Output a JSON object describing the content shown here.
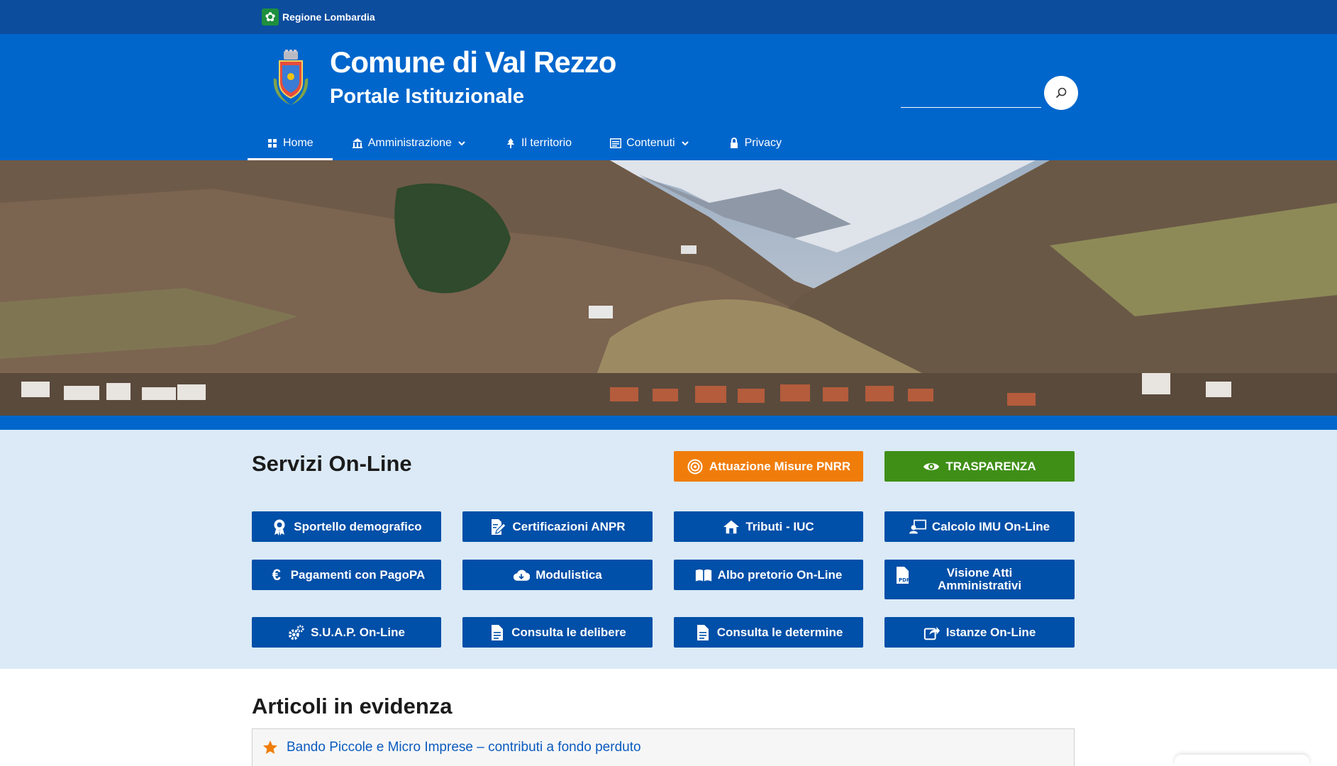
{
  "region": {
    "label": "Regione Lombardia"
  },
  "header": {
    "title": "Comune di Val Rezzo",
    "subtitle": "Portale Istituzionale",
    "search": {
      "value": "",
      "placeholder": ""
    }
  },
  "nav": [
    {
      "label": "Home",
      "icon": "grid-icon",
      "active": true
    },
    {
      "label": "Amministrazione",
      "icon": "building-icon",
      "dropdown": true
    },
    {
      "label": "Il territorio",
      "icon": "tree-icon"
    },
    {
      "label": "Contenuti",
      "icon": "list-icon",
      "dropdown": true
    },
    {
      "label": "Privacy",
      "icon": "lock-icon"
    }
  ],
  "services": {
    "title": "Servizi On-Line",
    "highlight": [
      {
        "label": "Attuazione Misure PNRR",
        "icon": "target-icon",
        "color": "#f07d0a"
      },
      {
        "label": "TRASPARENZA",
        "icon": "eye-icon",
        "color": "#3f8f17"
      }
    ],
    "buttons": [
      {
        "label": "Sportello demografico",
        "icon": "badge-icon"
      },
      {
        "label": "Certificazioni ANPR",
        "icon": "document-edit-icon"
      },
      {
        "label": "Tributi - IUC",
        "icon": "house-icon"
      },
      {
        "label": "Calcolo IMU On-Line",
        "icon": "user-monitor-icon"
      },
      {
        "label": "Pagamenti con PagoPA",
        "icon": "euro-icon"
      },
      {
        "label": "Modulistica",
        "icon": "cloud-download-icon"
      },
      {
        "label": "Albo pretorio On-Line",
        "icon": "book-icon"
      },
      {
        "label": "Visione Atti Amministrativi",
        "icon": "pdf-icon"
      },
      {
        "label": "S.U.A.P. On-Line",
        "icon": "gears-icon"
      },
      {
        "label": "Consulta le delibere",
        "icon": "file-icon"
      },
      {
        "label": "Consulta le determine",
        "icon": "file-icon"
      },
      {
        "label": "Istanze On-Line",
        "icon": "share-icon"
      }
    ]
  },
  "articles": {
    "title": "Articoli in evidenza",
    "items": [
      {
        "title": "Bando Piccole e Micro Imprese – contributi a fondo perduto",
        "icon": "star-icon"
      }
    ]
  },
  "colors": {
    "primary": "#0066cc",
    "top_bar": "#0d4d9e",
    "button_blue": "#004fa8",
    "services_bg": "#dbeaf6",
    "link": "#0b5bbf",
    "star": "#f07d0a"
  }
}
